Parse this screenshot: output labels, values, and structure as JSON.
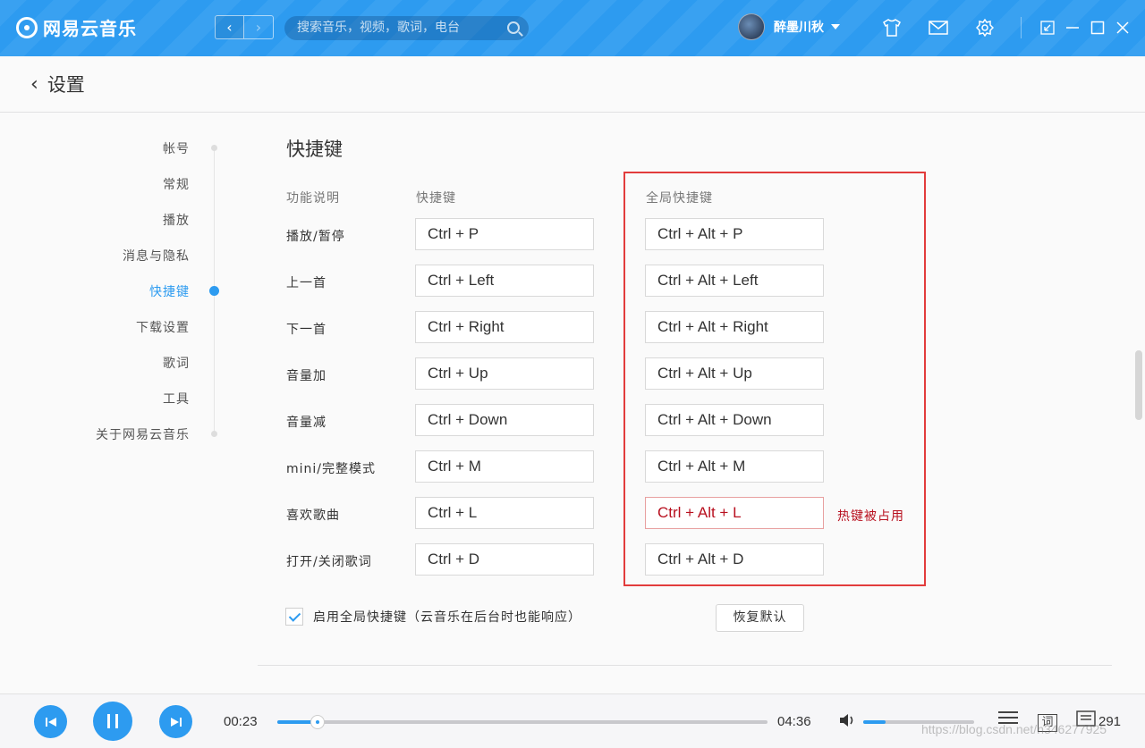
{
  "app": {
    "logo_text": "网易云音乐"
  },
  "topbar": {
    "back_glyph": "‹",
    "forward_glyph": "›",
    "search_placeholder": "搜索音乐，视频，歌词，电台",
    "username": "醉墨川秋"
  },
  "header": {
    "back_glyph": "‹",
    "title": "设置"
  },
  "sidenav": {
    "items": [
      "帐号",
      "常规",
      "播放",
      "消息与隐私",
      "快捷键",
      "下载设置",
      "歌词",
      "工具",
      "关于网易云音乐"
    ],
    "active": "快捷键"
  },
  "shortcuts": {
    "section_title": "快捷键",
    "col_function": "功能说明",
    "col_shortcut": "快捷键",
    "col_global": "全局快捷键",
    "rows": [
      {
        "label": "播放/暂停",
        "key": "Ctrl + P",
        "global": "Ctrl + Alt + P"
      },
      {
        "label": "上一首",
        "key": "Ctrl + Left",
        "global": "Ctrl + Alt + Left"
      },
      {
        "label": "下一首",
        "key": "Ctrl + Right",
        "global": "Ctrl + Alt + Right"
      },
      {
        "label": "音量加",
        "key": "Ctrl + Up",
        "global": "Ctrl + Alt + Up"
      },
      {
        "label": "音量减",
        "key": "Ctrl + Down",
        "global": "Ctrl + Alt + Down"
      },
      {
        "label": "mini/完整模式",
        "key": "Ctrl + M",
        "global": "Ctrl + Alt + M"
      },
      {
        "label": "喜欢歌曲",
        "key": "Ctrl + L",
        "global": "Ctrl + Alt + L"
      },
      {
        "label": "打开/关闭歌词",
        "key": "Ctrl + D",
        "global": "Ctrl + Alt + D"
      }
    ],
    "conflict_text": "热键被占用",
    "enable_global_label": "启用全局快捷键（云音乐在后台时也能响应）",
    "enable_global_checked": true,
    "restore_label": "恢复默认"
  },
  "player": {
    "current_time": "00:23",
    "total_time": "04:36",
    "progress_fraction": 0.083,
    "volume_fraction": 0.2,
    "lyrics_label": "词",
    "playlist_count": "291",
    "watermark": "https://blog.csdn.net/n346277925"
  },
  "colors": {
    "accent": "#2d9bf0",
    "error": "#b8101f",
    "highlight_frame": "#e23c3c"
  }
}
